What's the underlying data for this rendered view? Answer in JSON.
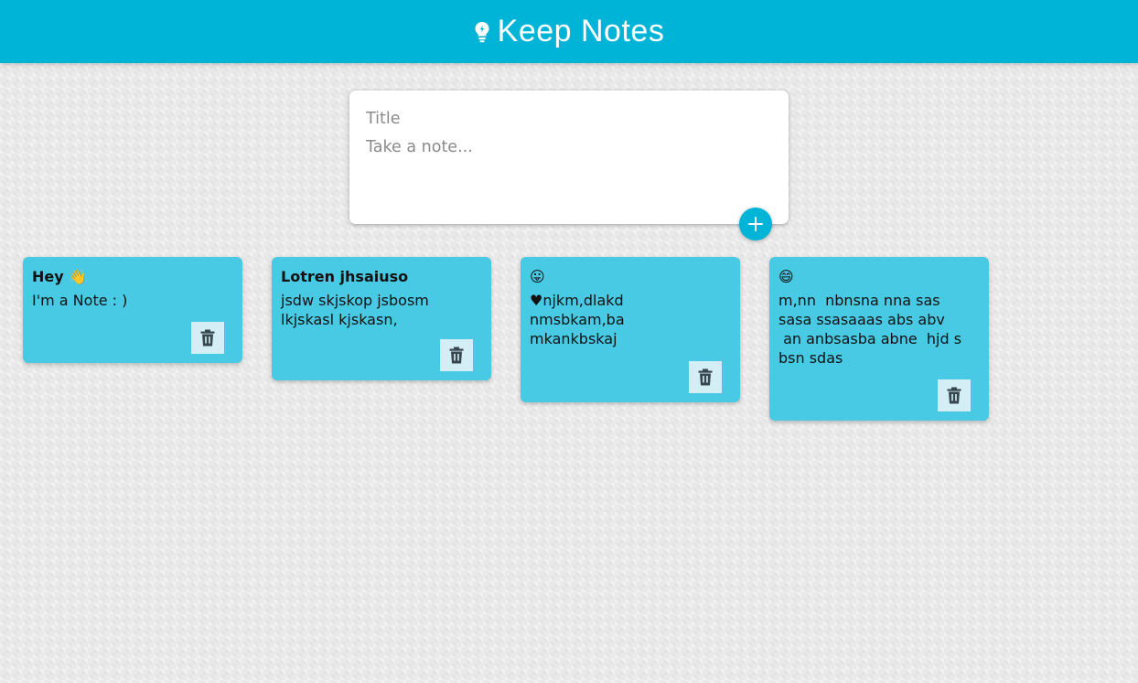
{
  "header": {
    "title": "Keep Notes",
    "logo_icon": "lightbulb-icon"
  },
  "composer": {
    "title_placeholder": "Title",
    "content_placeholder": "Take a note...",
    "add_icon": "plus-icon"
  },
  "notes": [
    {
      "title": "Hey 👋",
      "content": "I'm a Note : )"
    },
    {
      "title": "Lotren jhsaiuso",
      "content": "jsdw skjskop jsbosm\nlkjskasl kjskasn,"
    },
    {
      "title": "😛",
      "content": "♥njkm,dlakd\nnmsbkam,ba\nmkankbskaj"
    },
    {
      "title": "😄",
      "content": "m,nn  nbnsna nna sas\nsasa ssasaaas abs abv\n an anbsasba abne  hjd s\nbsn sdas"
    }
  ],
  "colors": {
    "header": "#00b4d8",
    "note": "#48cae4",
    "delete_button": "#d3eef4",
    "add_button": "#00b4d8"
  },
  "icons": {
    "delete": "trash-icon"
  }
}
